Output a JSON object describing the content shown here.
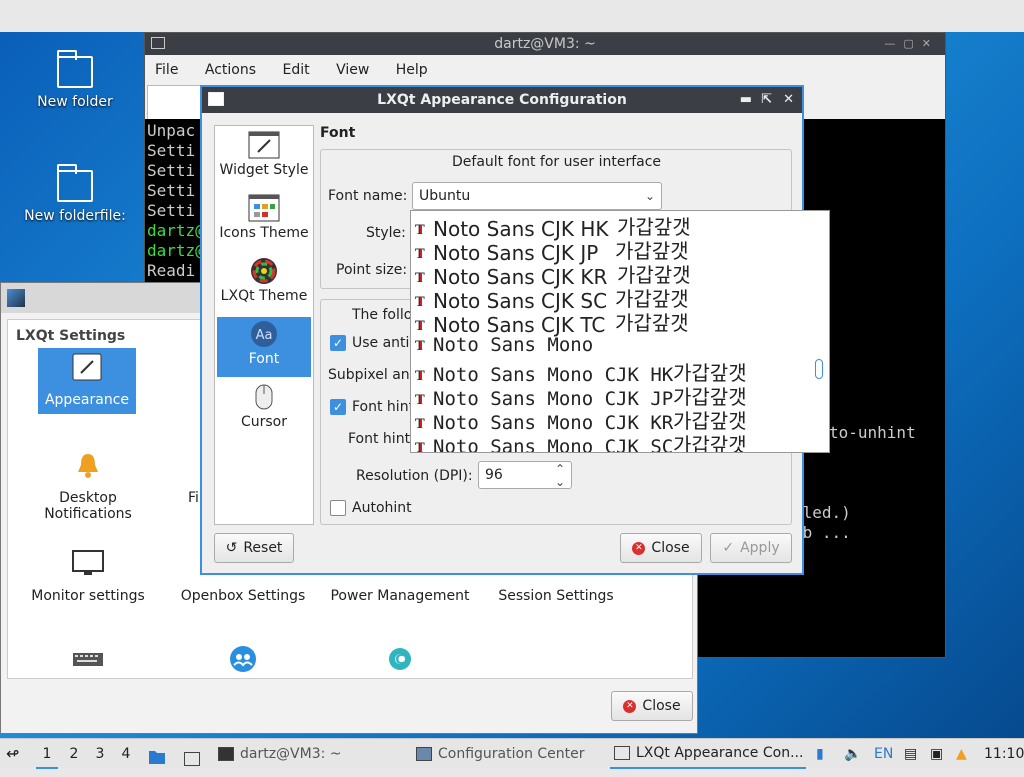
{
  "desktop": {
    "icons": [
      {
        "label": "New folder"
      },
      {
        "label": "New folderfile:"
      }
    ]
  },
  "terminal": {
    "title": "dartz@VM3: ~",
    "menu": [
      "File",
      "Actions",
      "Edit",
      "View",
      "Help"
    ],
    "lines": [
      "Unpac",
      "Setti",
      "Setti",
      "Setti",
      "Setti",
      "dartz@",
      "dartz@",
      "Readi"
    ],
    "right_lines": [
      "to-unhint",
      "lled.)",
      "eb ..."
    ]
  },
  "config_center": {
    "title": "LXQt Settings",
    "items": [
      {
        "label": "Appearance",
        "icon": "brush-icon"
      },
      {
        "label": "Desktop Notifications",
        "icon": "bell-icon"
      },
      {
        "label": "Fi",
        "icon": "file-icon"
      },
      {
        "label": "Monitor settings",
        "icon": "monitor-icon"
      },
      {
        "label": "Openbox Settings",
        "icon": "openbox-icon"
      },
      {
        "label": "Power Management",
        "icon": "power-icon"
      },
      {
        "label": "Session Settings",
        "icon": "session-icon"
      },
      {
        "label": "",
        "icon": "keyboard-icon"
      },
      {
        "label": "",
        "icon": "users-icon"
      },
      {
        "label": "",
        "icon": "gear-icon"
      }
    ],
    "close_label": "Close"
  },
  "appearance": {
    "title": "LXQt Appearance Configuration",
    "categories": [
      {
        "label": "Widget Style"
      },
      {
        "label": "Icons Theme"
      },
      {
        "label": "LXQt Theme"
      },
      {
        "label": "Font"
      },
      {
        "label": "Cursor"
      }
    ],
    "section_title": "Font",
    "group_title": "Default font for user interface",
    "font_name_label": "Font name:",
    "font_name_value": "Ubuntu",
    "style_label": "Style:",
    "point_size_label": "Point size:",
    "following_label": "The follo",
    "antialias_label": "Use antia",
    "subpixel_label": "Subpixel ant",
    "font_hint_label": "Font hint",
    "font_hint_style_label": "Font hint",
    "resolution_label": "Resolution (DPI):",
    "resolution_value": "96",
    "autohint_label": "Autohint",
    "reset_label": "Reset",
    "close_label": "Close",
    "apply_label": "Apply"
  },
  "font_list": [
    {
      "name": "Noto Sans CJK HK",
      "sample": "가갑갚갯"
    },
    {
      "name": "Noto Sans CJK JP",
      "sample": "가갑갚갯"
    },
    {
      "name": "Noto Sans CJK KR",
      "sample": "가갑갚갯"
    },
    {
      "name": "Noto Sans CJK SC",
      "sample": "가갑갚갯"
    },
    {
      "name": "Noto Sans CJK TC",
      "sample": "가갑갚갯"
    },
    {
      "name": "Noto Sans Mono",
      "sample": ""
    },
    {
      "name": "Noto Sans Mono CJK HK",
      "sample": "가갑갚갯"
    },
    {
      "name": "Noto Sans Mono CJK JP",
      "sample": "가갑갚갯"
    },
    {
      "name": "Noto Sans Mono CJK KR",
      "sample": "가갑갚갯"
    },
    {
      "name": "Noto Sans Mono CJK SC",
      "sample": "가갑갚갯"
    }
  ],
  "taskbar": {
    "desktops": [
      "1",
      "2",
      "3",
      "4"
    ],
    "tasks": [
      {
        "label": "dartz@VM3: ~"
      },
      {
        "label": "Configuration Center"
      },
      {
        "label": "LXQt Appearance Con..."
      }
    ],
    "keyboard_layout": "EN",
    "clock": "11:10"
  },
  "colors": {
    "accent": "#3d8fe0",
    "titlebar": "#3b3f45",
    "close_red": "#d9302e"
  }
}
